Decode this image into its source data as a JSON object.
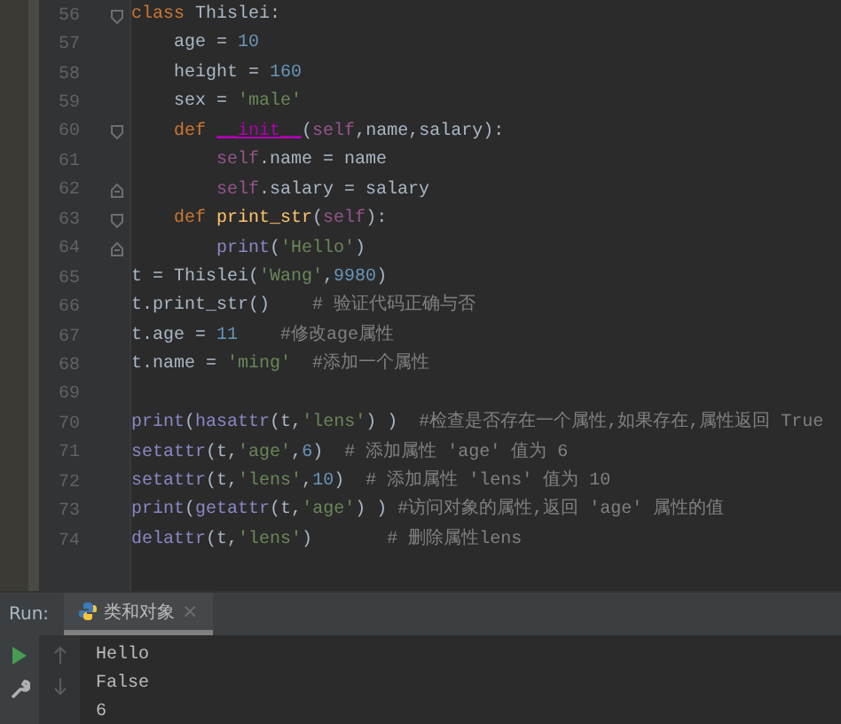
{
  "editor": {
    "lines": [
      {
        "number": "56",
        "fold_start": true,
        "tokens": [
          {
            "kind": "keyword",
            "text": "class "
          },
          {
            "kind": "plain",
            "text": "Thislei:"
          }
        ],
        "children": [
          {
            "number": "57",
            "tokens": [
              {
                "kind": "plain",
                "text": "age = "
              },
              {
                "kind": "number",
                "text": "10"
              }
            ]
          },
          {
            "number": "58",
            "tokens": [
              {
                "kind": "plain",
                "text": "height = "
              },
              {
                "kind": "number",
                "text": "160"
              }
            ]
          },
          {
            "number": "59",
            "tokens": [
              {
                "kind": "plain",
                "text": "sex = "
              },
              {
                "kind": "string",
                "text": "'male'"
              }
            ]
          },
          {
            "number": "60",
            "fold_start": true,
            "tokens": [
              {
                "kind": "keyword",
                "text": "def "
              },
              {
                "kind": "magic",
                "text": "__init__"
              },
              {
                "kind": "plain",
                "text": "("
              },
              {
                "kind": "self",
                "text": "self"
              },
              {
                "kind": "plain",
                "text": ",name,salary):"
              }
            ],
            "children": [
              {
                "number": "61",
                "tokens": [
                  {
                    "kind": "self",
                    "text": "self"
                  },
                  {
                    "kind": "plain",
                    "text": ".name = name"
                  }
                ]
              },
              {
                "number": "62",
                "fold_end": true,
                "tokens": [
                  {
                    "kind": "self",
                    "text": "self"
                  },
                  {
                    "kind": "plain",
                    "text": ".salary = salary"
                  }
                ]
              }
            ]
          },
          {
            "number": "63",
            "fold_start": true,
            "tokens": [
              {
                "kind": "keyword",
                "text": "def "
              },
              {
                "kind": "func",
                "text": "print_str"
              },
              {
                "kind": "plain",
                "text": "("
              },
              {
                "kind": "self",
                "text": "self"
              },
              {
                "kind": "plain",
                "text": "):"
              }
            ],
            "children": [
              {
                "number": "64",
                "fold_end": true,
                "tokens": [
                  {
                    "kind": "builtin",
                    "text": "print"
                  },
                  {
                    "kind": "plain",
                    "text": "("
                  },
                  {
                    "kind": "string",
                    "text": "'Hello'"
                  },
                  {
                    "kind": "plain",
                    "text": ")"
                  }
                ]
              }
            ]
          }
        ]
      },
      {
        "number": "65",
        "tokens": [
          {
            "kind": "plain",
            "text": "t = Thislei("
          },
          {
            "kind": "string",
            "text": "'Wang'"
          },
          {
            "kind": "plain",
            "text": ","
          },
          {
            "kind": "number",
            "text": "9980"
          },
          {
            "kind": "plain",
            "text": ")"
          }
        ]
      },
      {
        "number": "66",
        "tokens": [
          {
            "kind": "plain",
            "text": "t.print_str()    "
          },
          {
            "kind": "comment",
            "text": "# 验证代码正确与否"
          }
        ]
      },
      {
        "number": "67",
        "tokens": [
          {
            "kind": "plain",
            "text": "t.age = "
          },
          {
            "kind": "number",
            "text": "11    "
          },
          {
            "kind": "comment",
            "text": "#修改age属性"
          }
        ]
      },
      {
        "number": "68",
        "tokens": [
          {
            "kind": "plain",
            "text": "t.name = "
          },
          {
            "kind": "string",
            "text": "'ming'  "
          },
          {
            "kind": "comment",
            "text": "#添加一个属性"
          }
        ]
      },
      {
        "number": "69"
      },
      {
        "number": "70",
        "tokens": [
          {
            "kind": "builtin",
            "text": "print"
          },
          {
            "kind": "plain",
            "text": "("
          },
          {
            "kind": "builtin",
            "text": "hasattr"
          },
          {
            "kind": "plain",
            "text": "(t,"
          },
          {
            "kind": "string",
            "text": "'lens'"
          },
          {
            "kind": "plain",
            "text": ") )  "
          },
          {
            "kind": "comment",
            "text": "#检查是否存在一个属性,如果存在,属性返回 True"
          }
        ]
      },
      {
        "number": "71",
        "tokens": [
          {
            "kind": "builtin",
            "text": "setattr"
          },
          {
            "kind": "plain",
            "text": "(t,"
          },
          {
            "kind": "string",
            "text": "'age'"
          },
          {
            "kind": "plain",
            "text": ","
          },
          {
            "kind": "number",
            "text": "6"
          },
          {
            "kind": "plain",
            "text": ")  "
          },
          {
            "kind": "comment",
            "text": "# 添加属性 'age' 值为 6"
          }
        ]
      },
      {
        "number": "72",
        "tokens": [
          {
            "kind": "builtin",
            "text": "setattr"
          },
          {
            "kind": "plain",
            "text": "(t,"
          },
          {
            "kind": "string",
            "text": "'lens'"
          },
          {
            "kind": "plain",
            "text": ","
          },
          {
            "kind": "number",
            "text": "10"
          },
          {
            "kind": "plain",
            "text": ")  "
          },
          {
            "kind": "comment",
            "text": "# 添加属性 'lens' 值为 10"
          }
        ]
      },
      {
        "number": "73",
        "tokens": [
          {
            "kind": "builtin",
            "text": "print"
          },
          {
            "kind": "plain",
            "text": "("
          },
          {
            "kind": "builtin",
            "text": "getattr"
          },
          {
            "kind": "plain",
            "text": "(t,"
          },
          {
            "kind": "string",
            "text": "'age'"
          },
          {
            "kind": "plain",
            "text": ") ) "
          },
          {
            "kind": "comment",
            "text": "#访问对象的属性,返回 'age' 属性的值"
          }
        ]
      },
      {
        "number": "74",
        "tokens": [
          {
            "kind": "builtin",
            "text": "delattr"
          },
          {
            "kind": "plain",
            "text": "(t,"
          },
          {
            "kind": "string",
            "text": "'lens'"
          },
          {
            "kind": "plain",
            "text": ")       "
          },
          {
            "kind": "comment",
            "text": "# 删除属性lens"
          }
        ]
      }
    ]
  },
  "run_panel": {
    "label": "Run:",
    "tabs": [
      {
        "label": "类和对象",
        "close": "×",
        "selected": true
      }
    ],
    "output": [
      "Hello",
      "False",
      "6"
    ]
  }
}
